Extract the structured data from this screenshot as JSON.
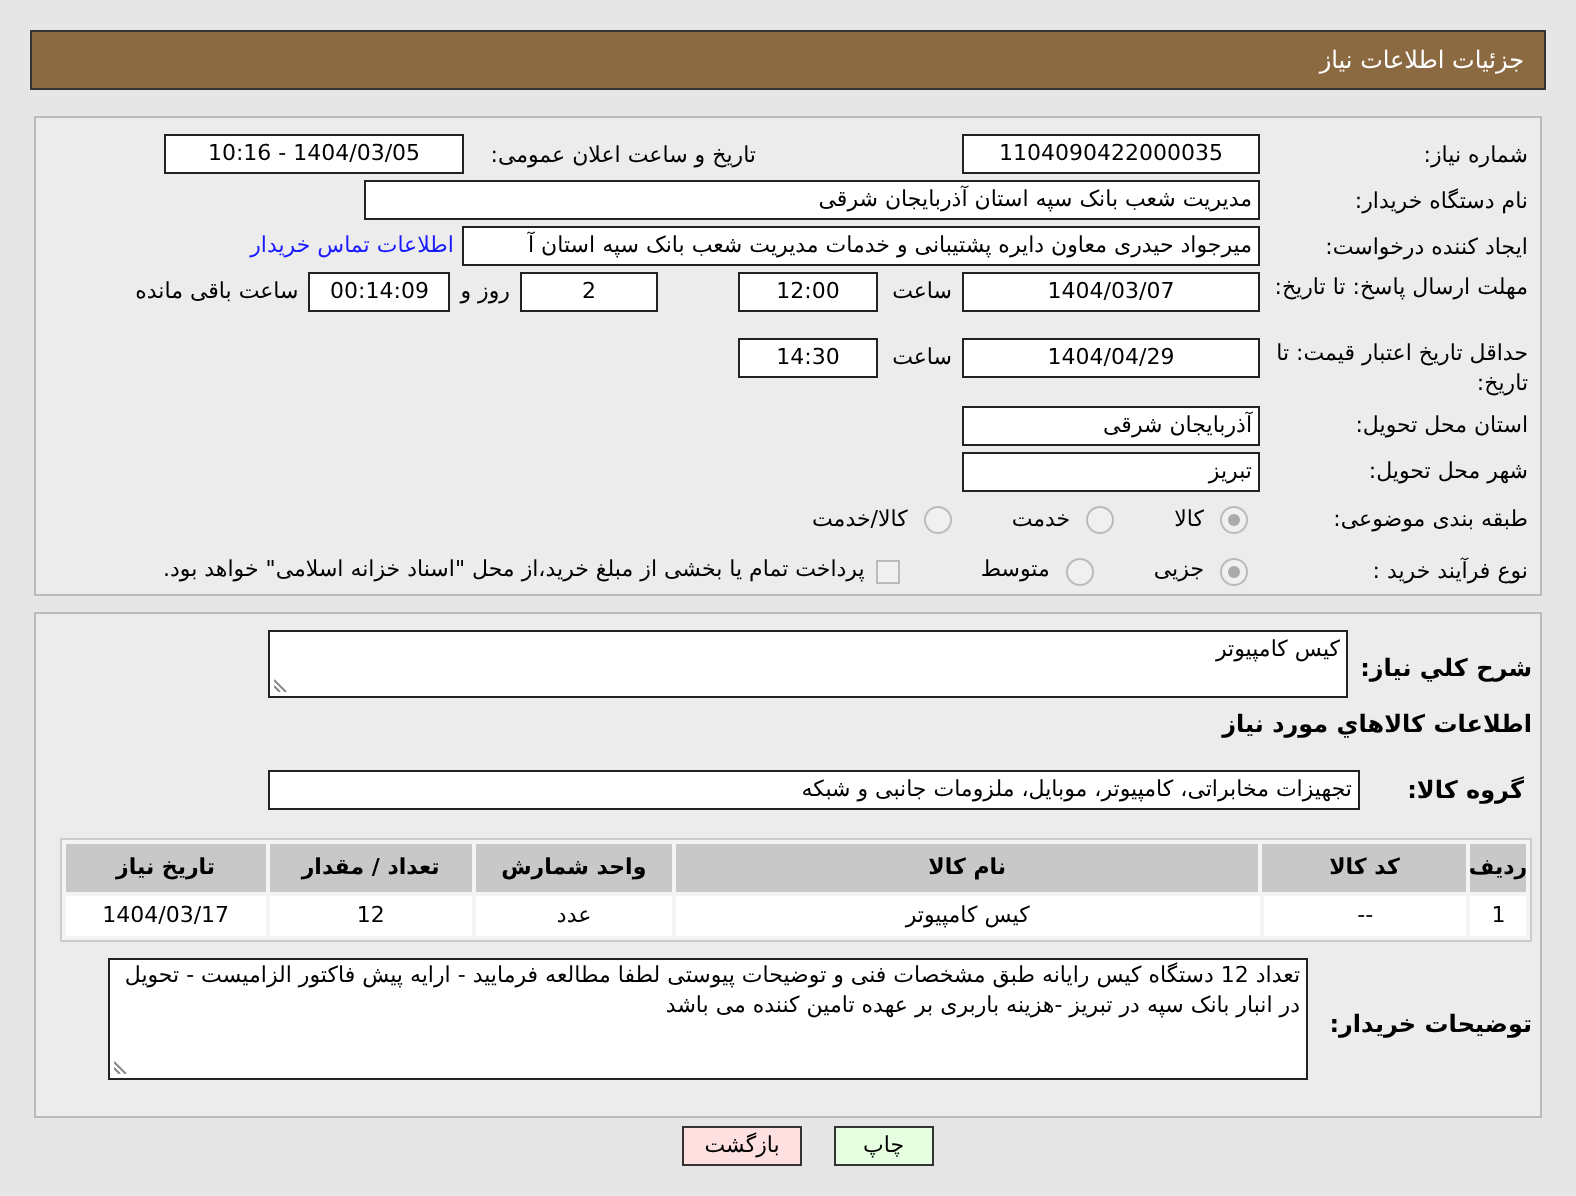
{
  "header": {
    "title": "جزئیات اطلاعات نیاز"
  },
  "need_number": {
    "label": "شماره نیاز:",
    "value": "1104090422000035"
  },
  "announce": {
    "label": "تاریخ و ساعت اعلان عمومی:",
    "value": "1404/03/05 - 10:16"
  },
  "buyer": {
    "label": "نام دستگاه خریدار:",
    "value": "مدیریت شعب بانک سپه استان آذربایجان شرقی"
  },
  "requester": {
    "label": "ایجاد کننده درخواست:",
    "value": "میرجواد حیدری معاون دایره پشتیبانی و خدمات مدیریت شعب بانک سپه استان آ",
    "link": "اطلاعات تماس خریدار"
  },
  "deadline": {
    "label": "مهلت ارسال پاسخ: تا تاریخ:",
    "date": "1404/03/07",
    "time_label": "ساعت",
    "time": "12:00",
    "days": "2",
    "days_label": "روز و",
    "remaining": "00:14:09",
    "remaining_label": "ساعت باقی مانده"
  },
  "validity": {
    "label": "حداقل تاریخ اعتبار قیمت: تا تاریخ:",
    "date": "1404/04/29",
    "time_label": "ساعت",
    "time": "14:30"
  },
  "province": {
    "label": "استان محل تحویل:",
    "value": "آذربایجان شرقی"
  },
  "city": {
    "label": "شهر محل تحویل:",
    "value": "تبریز"
  },
  "category": {
    "label": "طبقه بندی موضوعی:",
    "options": [
      {
        "label": "کالا",
        "selected": true
      },
      {
        "label": "خدمت",
        "selected": false
      },
      {
        "label": "کالا/خدمت",
        "selected": false
      }
    ]
  },
  "process": {
    "label": "نوع فرآیند خرید :",
    "options": [
      {
        "label": "جزیی",
        "selected": true
      },
      {
        "label": "متوسط",
        "selected": false
      }
    ],
    "payment": {
      "checked": false,
      "text": "پرداخت تمام یا بخشی از مبلغ خرید،از محل \"اسناد خزانه اسلامی\" خواهد بود."
    }
  },
  "description": {
    "label": "شرح کلي نیاز:",
    "value": "کیس کامپیوتر"
  },
  "goods_title": "اطلاعات کالاهاي مورد نیاز",
  "group": {
    "label": "گروه کالا:",
    "value": "تجهیزات مخابراتی، کامپیوتر، موبایل، ملزومات جانبی و شبکه"
  },
  "table": {
    "columns": [
      "ردیف",
      "کد کالا",
      "نام کالا",
      "واحد شمارش",
      "تعداد / مقدار",
      "تاریخ نیاز"
    ],
    "rows": [
      [
        "1",
        "--",
        "کیس کامپیوتر",
        "عدد",
        "12",
        "1404/03/17"
      ]
    ]
  },
  "notes": {
    "label": "توضیحات خریدار:",
    "value": "تعداد 12 دستگاه کیس رایانه طبق مشخصات فنی و توضیحات پیوستی لطفا مطالعه فرمایید - ارایه پیش فاکتور الزامیست - تحویل در انبار بانک سپه در تبریز  -هزینه باربری بر عهده تامین کننده می باشد"
  },
  "buttons": [
    {
      "label": "چاپ",
      "kind": "print"
    },
    {
      "label": "بازگشت",
      "kind": "back"
    }
  ]
}
